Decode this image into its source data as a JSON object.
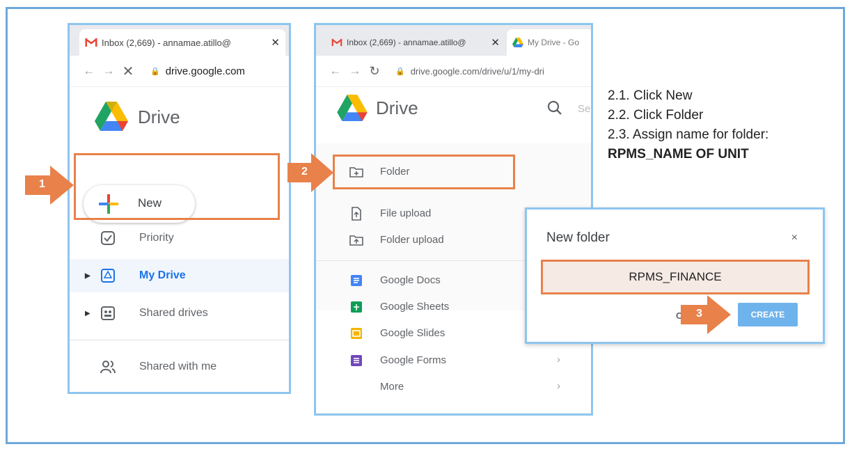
{
  "colors": {
    "accent_orange": "#e8814a",
    "frame_blue": "#6fa8dc",
    "create_blue": "#6fb3ec"
  },
  "panel1": {
    "tab_title": "Inbox (2,669) - annamae.atillo@",
    "tab_close": "✕",
    "url": "drive.google.com",
    "app_name": "Drive",
    "new_label": "New",
    "step": "1",
    "sidebar": [
      {
        "label": "Priority",
        "icon": "priority-check-icon"
      },
      {
        "label": "My Drive",
        "icon": "my-drive-icon"
      },
      {
        "label": "Shared drives",
        "icon": "shared-drives-icon"
      },
      {
        "label": "Shared with me",
        "icon": "shared-with-me-icon"
      }
    ]
  },
  "panel2": {
    "tab1_title": "Inbox (2,669) - annamae.atillo@",
    "tab_close": "✕",
    "tab2_title": "My Drive - Go",
    "url": "drive.google.com/drive/u/1/my-dri",
    "app_name": "Drive",
    "search_stub": "Se",
    "step": "2",
    "menu": [
      {
        "label": "Folder",
        "icon": "new-folder-icon"
      },
      {
        "label": "File upload",
        "icon": "file-upload-icon"
      },
      {
        "label": "Folder upload",
        "icon": "folder-upload-icon"
      },
      {
        "label": "Google Docs",
        "icon": "google-docs-icon"
      },
      {
        "label": "Google Sheets",
        "icon": "google-sheets-icon"
      },
      {
        "label": "Google Slides",
        "icon": "google-slides-icon"
      },
      {
        "label": "Google Forms",
        "icon": "google-forms-icon"
      },
      {
        "label": "More",
        "icon": ""
      }
    ]
  },
  "instructions": {
    "line1": "2.1. Click New",
    "line2": "2.2. Click Folder",
    "line3": "2.3. Assign name for folder:",
    "line4": "RPMS_NAME OF UNIT"
  },
  "dialog": {
    "title": "New folder",
    "close": "×",
    "folder_name": "RPMS_FINANCE",
    "cancel_label": "C",
    "create_label": "CREATE",
    "step": "3"
  }
}
